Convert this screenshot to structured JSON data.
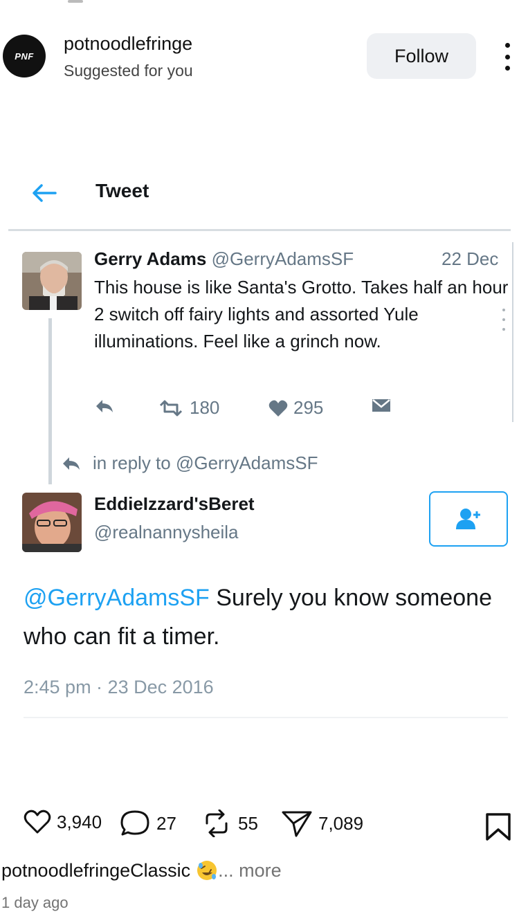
{
  "post": {
    "avatar_text": "PNF",
    "author": "potnoodlefringe",
    "subtitle": "Suggested for you",
    "follow_label": "Follow"
  },
  "tweet_screen": {
    "title": "Tweet",
    "original": {
      "name": "Gerry Adams",
      "handle": "@GerryAdamsSF",
      "date": "22 Dec",
      "text": "This house is like Santa's Grotto. Takes half an hour 2 switch off fairy lights and assorted Yule illuminations. Feel like a grinch now.",
      "retweets": "180",
      "likes": "295"
    },
    "reply_to": "in reply to @GerryAdamsSF",
    "reply": {
      "name": "EddieIzzard'sBeret",
      "handle": "@realnannysheila",
      "mention": "@GerryAdamsSF",
      "text": " Surely you know someone who can fit a timer.",
      "time": "2:45 pm · 23 Dec 2016"
    }
  },
  "actions": {
    "likes": "3,940",
    "comments": "27",
    "reposts": "55",
    "shares": "7,089"
  },
  "caption": {
    "user": "potnoodlefringe",
    "text": " Classic",
    "more": "... more",
    "emoji": "rolling-on-floor-laughing"
  },
  "time_ago": "1 day ago",
  "colors": {
    "twitter_blue": "#1da1f2",
    "twitter_gray": "#657786",
    "follow_bg": "#eef0f3"
  }
}
